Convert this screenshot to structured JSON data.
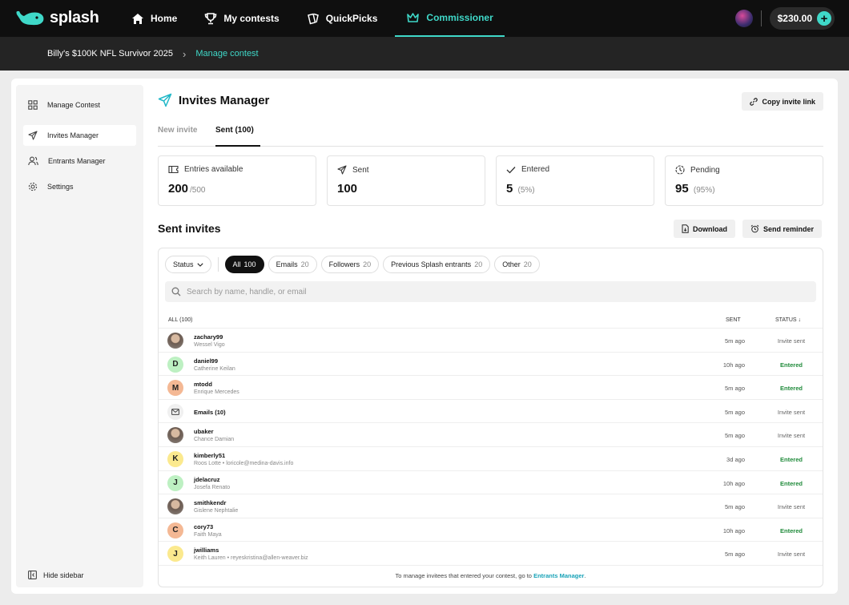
{
  "brand": {
    "name": "splash"
  },
  "nav": {
    "items": [
      {
        "label": "Home",
        "icon": "home-icon"
      },
      {
        "label": "My contests",
        "icon": "trophy-icon"
      },
      {
        "label": "QuickPicks",
        "icon": "cards-icon"
      },
      {
        "label": "Commissioner",
        "icon": "crown-icon"
      }
    ],
    "active": "Commissioner",
    "balance": "$230.00",
    "accent": "#3fd8c8"
  },
  "breadcrumb": {
    "contest": "Billy's $100K NFL Survivor 2025",
    "current": "Manage contest"
  },
  "sidebar": {
    "items": [
      {
        "label": "Manage Contest",
        "icon": "grid-icon"
      },
      {
        "label": "Invites Manager",
        "icon": "send-icon"
      },
      {
        "label": "Entrants Manager",
        "icon": "users-icon"
      },
      {
        "label": "Settings",
        "icon": "gear-icon"
      }
    ],
    "hide_label": "Hide sidebar"
  },
  "page": {
    "title": "Invites Manager",
    "copy_link": "Copy invite link",
    "tabs": [
      {
        "label": "New invite"
      },
      {
        "label": "Sent (100)"
      }
    ]
  },
  "stats": [
    {
      "label": "Entries available",
      "value": "200",
      "sub": "/500",
      "icon": "ticket-icon"
    },
    {
      "label": "Sent",
      "value": "100",
      "sub": "",
      "icon": "send-icon"
    },
    {
      "label": "Entered",
      "value": "5",
      "sub": "(5%)",
      "icon": "check-icon"
    },
    {
      "label": "Pending",
      "value": "95",
      "sub": "(95%)",
      "icon": "clock-icon"
    }
  ],
  "sent_invites": {
    "title": "Sent invites",
    "download": "Download",
    "send_reminder": "Send reminder",
    "status_filter": "Status",
    "filters": [
      {
        "label": "All",
        "count": "100"
      },
      {
        "label": "Emails",
        "count": "20"
      },
      {
        "label": "Followers",
        "count": "20"
      },
      {
        "label": "Previous Splash entrants",
        "count": "20"
      },
      {
        "label": "Other",
        "count": "20"
      }
    ],
    "search_placeholder": "Search by name, handle, or email",
    "columns": {
      "all": "ALL (100)",
      "sent": "SENT",
      "status": "STATUS ↓"
    },
    "rows": [
      {
        "handle": "zachary99",
        "sub": "Wessel Vigo",
        "sent": "5m ago",
        "status": "Invite sent",
        "avatar": "photo",
        "initial": "",
        "color": ""
      },
      {
        "handle": "daniel99",
        "sub": "Catherine Keilan",
        "sent": "10h ago",
        "status": "Entered",
        "avatar": "letter",
        "initial": "D",
        "color": "#bdf0c2"
      },
      {
        "handle": "mtodd",
        "sub": "Enrique Mercedes",
        "sent": "5m ago",
        "status": "Entered",
        "avatar": "letter",
        "initial": "M",
        "color": "#f4b894"
      },
      {
        "handle": "Emails (10)",
        "sub": "",
        "sent": "5m ago",
        "status": "Invite sent",
        "avatar": "mail",
        "initial": "",
        "color": ""
      },
      {
        "handle": "ubaker",
        "sub": "Chance Damian",
        "sent": "5m ago",
        "status": "Invite sent",
        "avatar": "photo",
        "initial": "",
        "color": ""
      },
      {
        "handle": "kimberly51",
        "sub": "Roos Lotte • loricole@medina-davis.info",
        "sent": "3d ago",
        "status": "Entered",
        "avatar": "letter",
        "initial": "K",
        "color": "#fbe98e"
      },
      {
        "handle": "jdelacruz",
        "sub": "Josefa Renato",
        "sent": "10h ago",
        "status": "Entered",
        "avatar": "letter",
        "initial": "J",
        "color": "#bdf0c2"
      },
      {
        "handle": "smithkendr",
        "sub": "Gislene Nephtalie",
        "sent": "5m ago",
        "status": "Invite sent",
        "avatar": "photo",
        "initial": "",
        "color": ""
      },
      {
        "handle": "cory73",
        "sub": "Faith Maya",
        "sent": "10h ago",
        "status": "Entered",
        "avatar": "letter",
        "initial": "C",
        "color": "#f4b894"
      },
      {
        "handle": "jwilliams",
        "sub": "Keith Lauren • reyeskristina@allen-weaver.biz",
        "sent": "5m ago",
        "status": "Invite sent",
        "avatar": "letter",
        "initial": "J",
        "color": "#fbe98e"
      }
    ],
    "footer_text": "To manage invitees that entered your contest, go to",
    "footer_link": "Entrants Manager",
    "entered_color": "#1f8a3a"
  }
}
